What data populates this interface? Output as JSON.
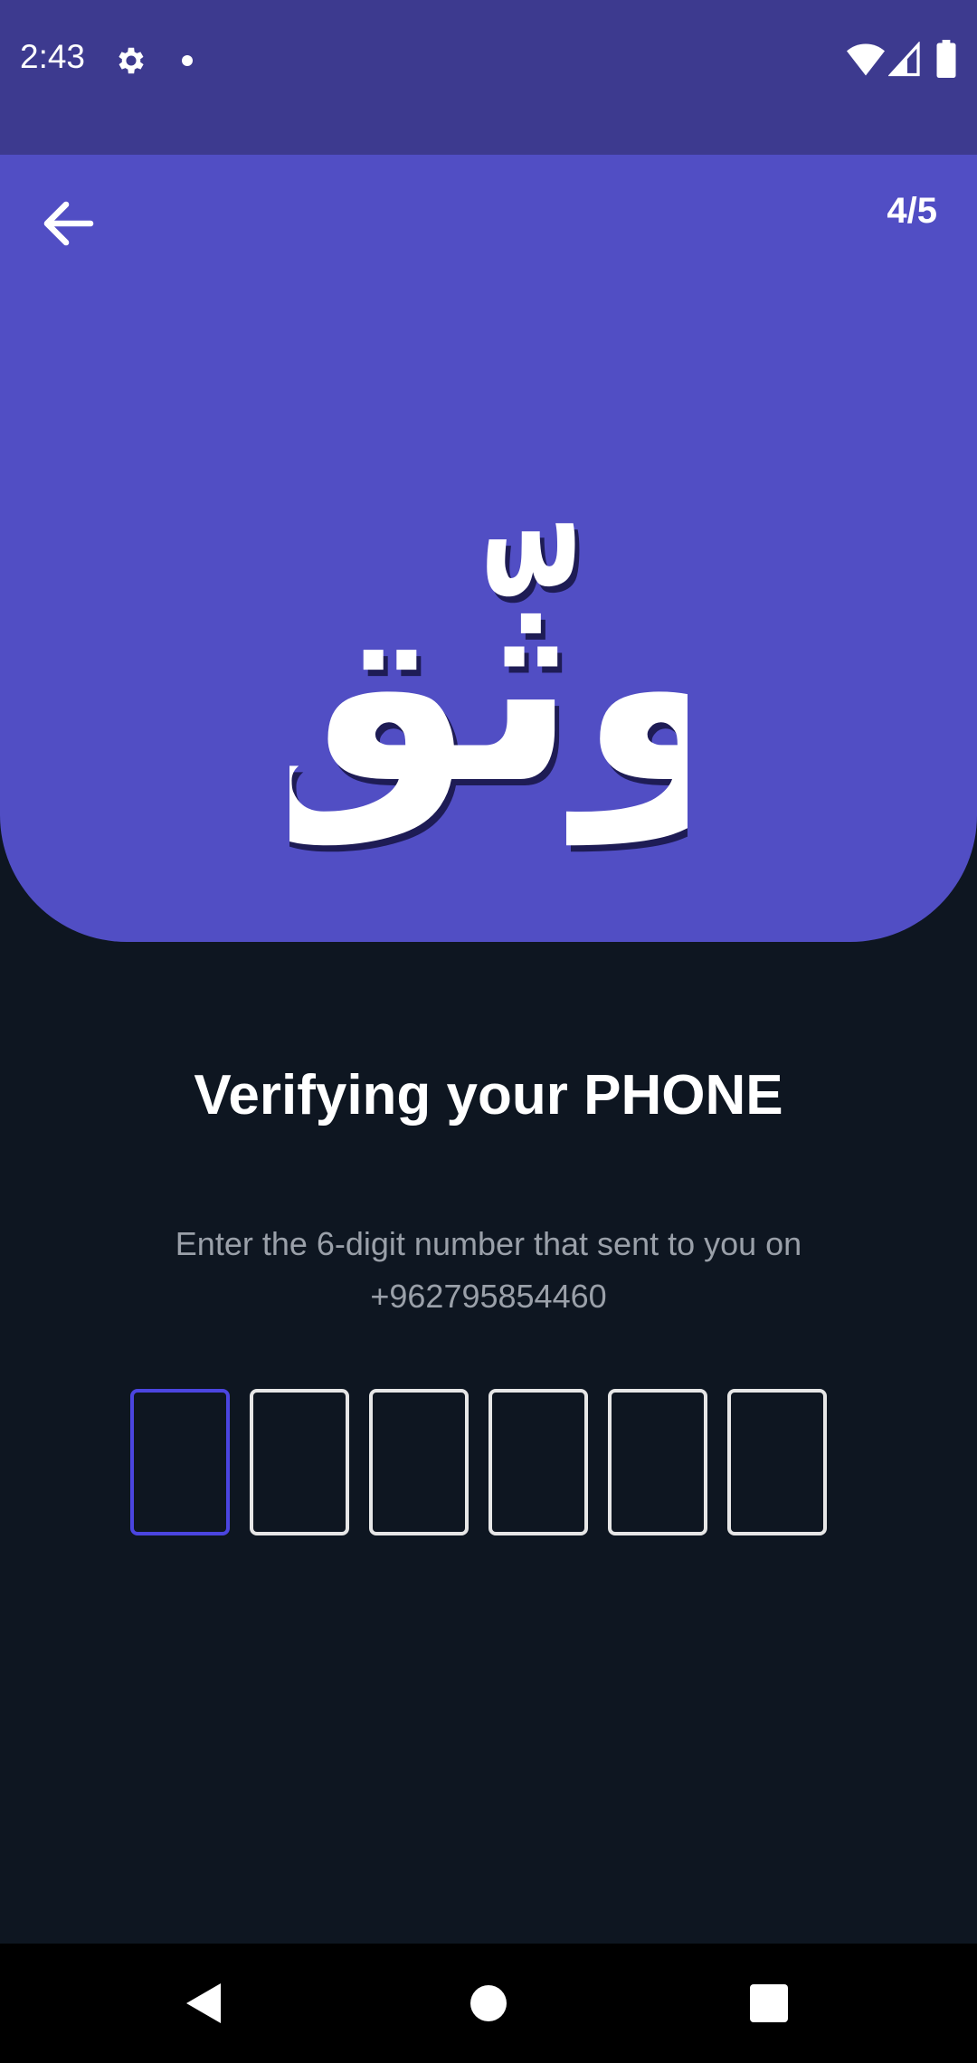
{
  "status_bar": {
    "time": "2:43",
    "icons": [
      "gear-icon",
      "notification-dot-icon",
      "wifi-icon",
      "signal-icon",
      "battery-icon"
    ]
  },
  "header": {
    "back_icon": "arrow-left-icon",
    "step": "4/5",
    "logo_text": "وثّق"
  },
  "verify": {
    "title": "Verifying your PHONE",
    "instruction": "Enter the 6-digit number that sent to you on",
    "phone": "+962795854460",
    "code_digits": [
      "",
      "",
      "",
      "",
      "",
      ""
    ],
    "active_index": 0
  },
  "nav_bar": {
    "icons": [
      "back-triangle-icon",
      "home-circle-icon",
      "recents-square-icon"
    ]
  },
  "colors": {
    "status_bar": "#3d3a8f",
    "header": "#514ec4",
    "background": "#0e1621",
    "active_box": "#4b45e0",
    "box_border": "#e6e6e6",
    "subtitle": "#9aa0a9"
  }
}
